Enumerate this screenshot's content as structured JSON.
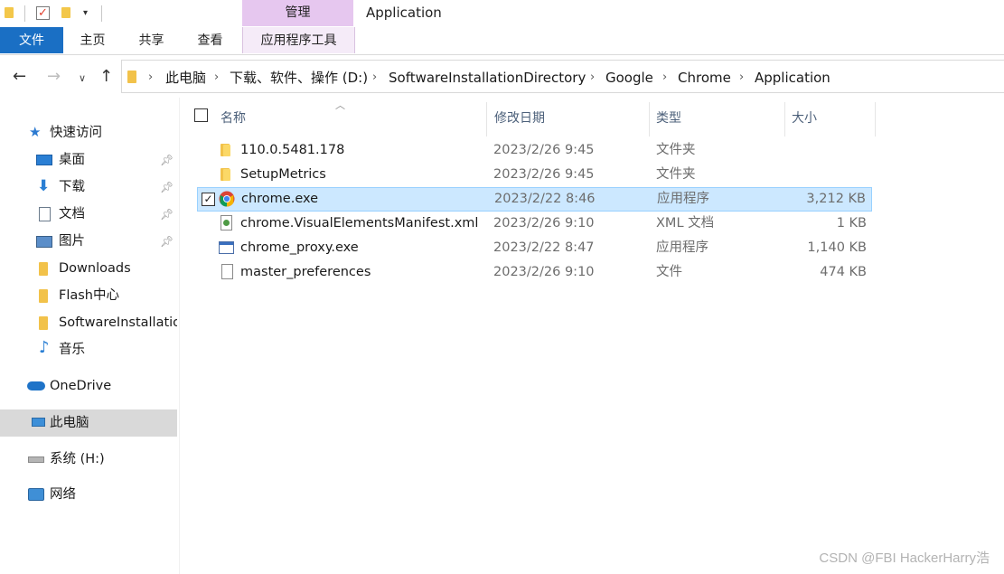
{
  "window": {
    "title": "Application"
  },
  "ribbon": {
    "context_group": "管理",
    "tabs": [
      {
        "label": "文件"
      },
      {
        "label": "主页"
      },
      {
        "label": "共享"
      },
      {
        "label": "查看"
      },
      {
        "label": "应用程序工具"
      }
    ]
  },
  "address": {
    "breadcrumb": [
      "此电脑",
      "下载、软件、操作 (D:)",
      "SoftwareInstallationDirectory",
      "Google",
      "Chrome",
      "Application"
    ]
  },
  "sidebar": {
    "quick_access": "快速访问",
    "items": [
      {
        "label": "桌面",
        "icon": "desktop-icon",
        "pinned": true
      },
      {
        "label": "下载",
        "icon": "download-icon",
        "pinned": true
      },
      {
        "label": "文档",
        "icon": "document-icon",
        "pinned": true
      },
      {
        "label": "图片",
        "icon": "picture-icon",
        "pinned": true
      },
      {
        "label": "Downloads",
        "icon": "folder-icon",
        "pinned": false
      },
      {
        "label": "Flash中心",
        "icon": "folder-icon",
        "pinned": false
      },
      {
        "label": "SoftwareInstallatio",
        "icon": "folder-icon",
        "pinned": false
      },
      {
        "label": "音乐",
        "icon": "music-icon",
        "pinned": false
      }
    ],
    "onedrive": "OneDrive",
    "this_pc": "此电脑",
    "drive": "系统 (H:)",
    "network": "网络"
  },
  "columns": {
    "name": "名称",
    "date": "修改日期",
    "type": "类型",
    "size": "大小"
  },
  "files": [
    {
      "name": "110.0.5481.178",
      "date": "2023/2/26 9:45",
      "type": "文件夹",
      "size": "",
      "icon": "folder-icon"
    },
    {
      "name": "SetupMetrics",
      "date": "2023/2/26 9:45",
      "type": "文件夹",
      "size": "",
      "icon": "folder-icon"
    },
    {
      "name": "chrome.exe",
      "date": "2023/2/22 8:46",
      "type": "应用程序",
      "size": "3,212 KB",
      "icon": "chrome-icon",
      "selected": true
    },
    {
      "name": "chrome.VisualElementsManifest.xml",
      "date": "2023/2/26 9:10",
      "type": "XML 文档",
      "size": "1 KB",
      "icon": "xml-file-icon"
    },
    {
      "name": "chrome_proxy.exe",
      "date": "2023/2/22 8:47",
      "type": "应用程序",
      "size": "1,140 KB",
      "icon": "exe-icon"
    },
    {
      "name": "master_preferences",
      "date": "2023/2/26 9:10",
      "type": "文件",
      "size": "474 KB",
      "icon": "file-icon"
    }
  ],
  "watermark": "CSDN @FBI HackerHarry浩",
  "colors": {
    "accent": "#1a6fc4",
    "context_tab": "#e6c7ef",
    "selection": "#cce8ff"
  }
}
